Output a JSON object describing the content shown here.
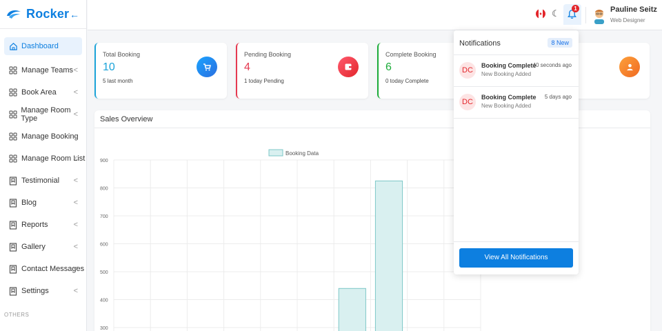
{
  "brand": {
    "name": "Rocker",
    "color": "#0d7fe0",
    "toggle_icon": "arrow-left-icon"
  },
  "sidebar": {
    "items": [
      {
        "label": "Dashboard",
        "icon": "home-icon",
        "active": true
      },
      {
        "label": "Manage Teams",
        "icon": "grid-icon"
      },
      {
        "label": "Book Area",
        "icon": "grid-icon"
      },
      {
        "label": "Manage Room Type",
        "icon": "grid-icon"
      },
      {
        "label": "Manage Booking",
        "icon": "grid-icon"
      },
      {
        "label": "Manage Room List",
        "icon": "grid-icon"
      },
      {
        "label": "Testimonial",
        "icon": "bookmark-icon"
      },
      {
        "label": "Blog",
        "icon": "bookmark-icon"
      },
      {
        "label": "Reports",
        "icon": "bookmark-icon"
      },
      {
        "label": "Gallery",
        "icon": "bookmark-icon"
      },
      {
        "label": "Contact Messages",
        "icon": "bookmark-icon"
      },
      {
        "label": "Settings",
        "icon": "bookmark-icon"
      }
    ],
    "section_label": "OTHERS",
    "arrow": "<"
  },
  "topbar": {
    "badge_count": "1",
    "user_name": "Pauline Seitz",
    "user_role": "Web Designer"
  },
  "cards": [
    {
      "title": "Total Booking",
      "value": "10",
      "sub": "5 last month",
      "color": "#1aa3d9",
      "icon": "cart-icon"
    },
    {
      "title": "Pending Booking",
      "value": "4",
      "sub": "1 today Pending",
      "color": "#e53950",
      "icon": "wallet-icon"
    },
    {
      "title": "Complete Booking",
      "value": "6",
      "sub": "0 today Complete",
      "color": "#1bab39",
      "icon": "check-icon"
    }
  ],
  "sales": {
    "title": "Sales Overview"
  },
  "chart_data": {
    "type": "bar",
    "legend": [
      "Booking Data"
    ],
    "series": [
      {
        "name": "Booking Data",
        "values": [
          0,
          0,
          0,
          0,
          0,
          0,
          440,
          825,
          0,
          0
        ]
      }
    ],
    "y_ticks": [
      900,
      800,
      700,
      600,
      500,
      400,
      300
    ],
    "ylim": [
      250,
      900
    ],
    "grid": true,
    "bar_color": "#d9f0f0",
    "bar_border": "#7cc7c7"
  },
  "notifications": {
    "title": "Notifications",
    "badge": "8 New",
    "items": [
      {
        "initials": "DC",
        "name": "Booking Complete",
        "message": "New Booking Added",
        "time": "40 seconds ago"
      },
      {
        "initials": "DC",
        "name": "Booking Complete",
        "message": "New Booking Added",
        "time": "5 days ago"
      }
    ],
    "button": "View All Notifications"
  }
}
